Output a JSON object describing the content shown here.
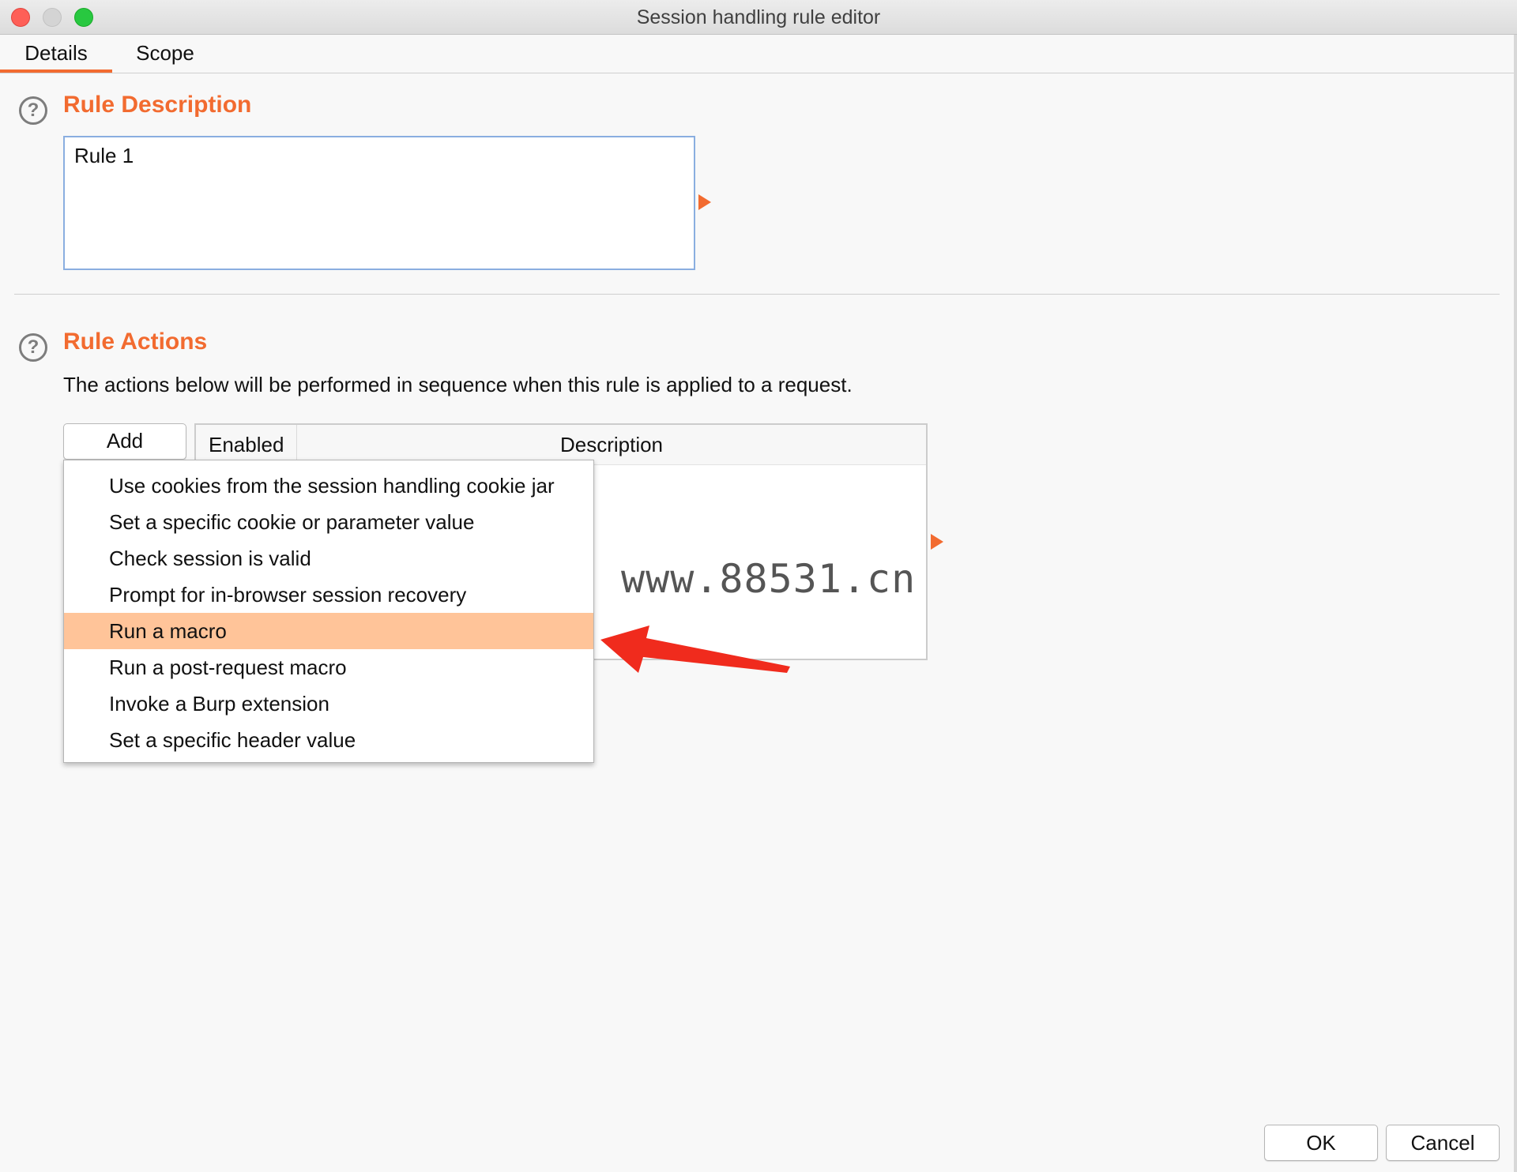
{
  "window": {
    "title": "Session handling rule editor"
  },
  "tabs": [
    {
      "label": "Details",
      "active": true
    },
    {
      "label": "Scope",
      "active": false
    }
  ],
  "rule_description": {
    "heading": "Rule Description",
    "value": "Rule 1",
    "help_icon": "?"
  },
  "rule_actions": {
    "heading": "Rule Actions",
    "help_icon": "?",
    "description": "The actions below will be performed in sequence when this rule is applied to a request.",
    "add_label": "Add",
    "columns": [
      "Enabled",
      "Description"
    ]
  },
  "add_menu": {
    "items": [
      "Use cookies from the session handling cookie jar",
      "Set a specific cookie or parameter value",
      "Check session is valid",
      "Prompt for in-browser session recovery",
      "Run a macro",
      "Run a post-request macro",
      "Invoke a Burp extension",
      "Set a specific header value"
    ],
    "highlighted": "Run a macro"
  },
  "watermark": "www.88531.cn",
  "footer": {
    "ok_label": "OK",
    "cancel_label": "Cancel"
  },
  "colors": {
    "accent": "#f26b30",
    "highlight": "#ffc499",
    "annotation_arrow": "#f02b1d"
  }
}
